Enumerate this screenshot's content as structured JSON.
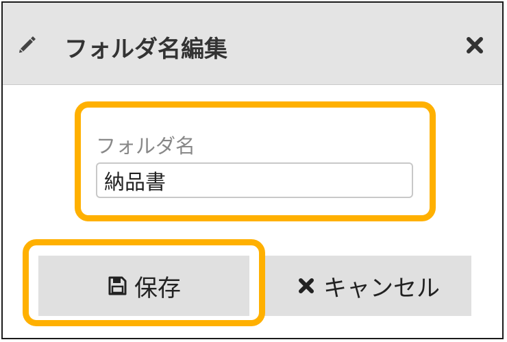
{
  "dialog": {
    "title": "フォルダ名編集",
    "title_icon": "pencil-icon",
    "close_icon": "close-icon"
  },
  "form": {
    "label": "フォルダ名",
    "value": "納品書"
  },
  "buttons": {
    "save_label": "保存",
    "save_icon": "floppy-disk-icon",
    "cancel_label": "キャンセル",
    "cancel_icon": "x-icon"
  },
  "colors": {
    "highlight": "#ffb000",
    "titlebar": "#e4e4e4",
    "button": "#e0e0e0"
  }
}
